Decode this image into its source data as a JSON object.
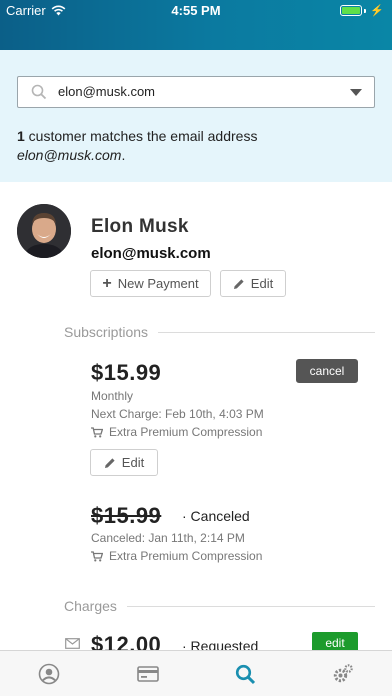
{
  "status_bar": {
    "carrier": "Carrier",
    "time": "4:55 PM",
    "battery_level": 1.0,
    "battery_color": "#5fe04a",
    "icons": [
      "wifi-icon",
      "battery-icon",
      "charging-bolt-icon"
    ]
  },
  "colors": {
    "header": "#0b6f96",
    "search_panel": "#e5f5fb",
    "tab_active": "#1a8fb0",
    "edit_green": "#1c9b2c"
  },
  "search": {
    "value": "elon@musk.com",
    "icons": [
      "search-icon",
      "dropdown-caret-icon"
    ]
  },
  "match": {
    "count": "1",
    "text": " customer matches the email address",
    "email": "elon@musk.com",
    "suffix": "."
  },
  "customer": {
    "name": "Elon Musk",
    "email": "elon@musk.com",
    "new_payment_label": "New Payment",
    "edit_label": "Edit"
  },
  "subscriptions": {
    "heading": "Subscriptions",
    "items": [
      {
        "amount": "$15.99",
        "interval": "Monthly",
        "next_charge": "Next Charge: Feb 10th, 4:03 PM",
        "product": "Extra Premium Compression",
        "cancel_label": "cancel",
        "edit_label": "Edit"
      },
      {
        "amount": "$15.99",
        "status": "· Canceled",
        "canceled": "Canceled: Jan 11th, 2:14 PM",
        "product": "Extra Premium Compression"
      }
    ]
  },
  "charges": {
    "heading": "Charges",
    "items": [
      {
        "amount": "$12.00",
        "status": "· Requested",
        "edit_label": "edit"
      }
    ]
  },
  "tabbar": {
    "tabs": [
      "profile-icon",
      "card-icon",
      "search-icon",
      "settings-icon"
    ],
    "active": "search-icon"
  }
}
